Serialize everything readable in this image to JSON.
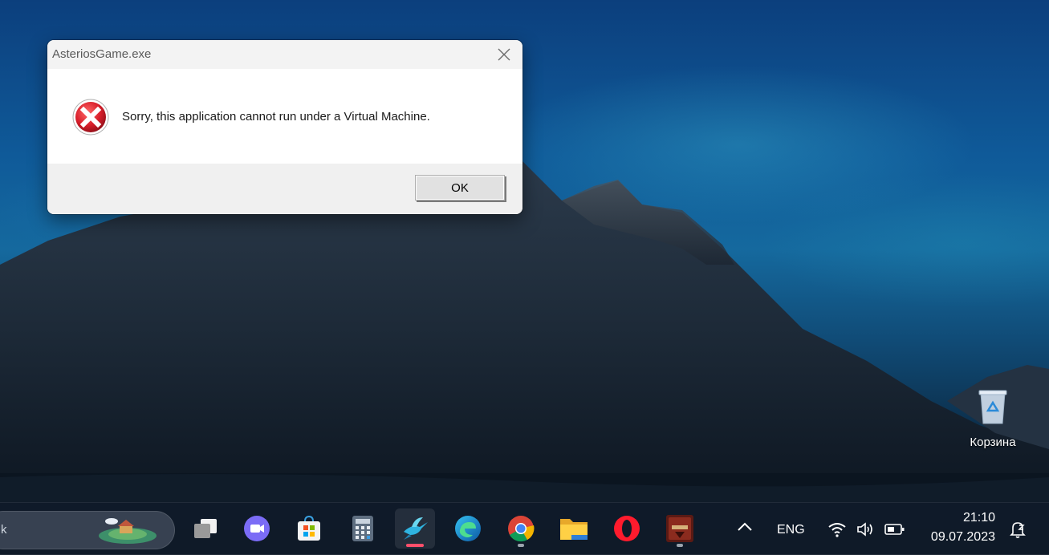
{
  "dialog": {
    "title": "AsteriosGame.exe",
    "message": "Sorry, this application cannot run under a Virtual Machine.",
    "ok_label": "OK",
    "close_icon": "close-icon",
    "status_icon": "error-icon"
  },
  "desktop": {
    "recycle_bin_label": "Корзина"
  },
  "taskbar": {
    "search_text": "k",
    "apps": [
      {
        "name": "task-view"
      },
      {
        "name": "teams"
      },
      {
        "name": "microsoft-store"
      },
      {
        "name": "calculator"
      },
      {
        "name": "hummingbird-app",
        "active": true
      },
      {
        "name": "edge"
      },
      {
        "name": "chrome"
      },
      {
        "name": "file-explorer"
      },
      {
        "name": "opera"
      },
      {
        "name": "lineage-game"
      }
    ],
    "tray": {
      "language": "ENG",
      "time": "21:10",
      "date": "09.07.2023"
    }
  },
  "colors": {
    "active_indicator": "#ff4f6b",
    "error_red": "#d81e2a"
  }
}
